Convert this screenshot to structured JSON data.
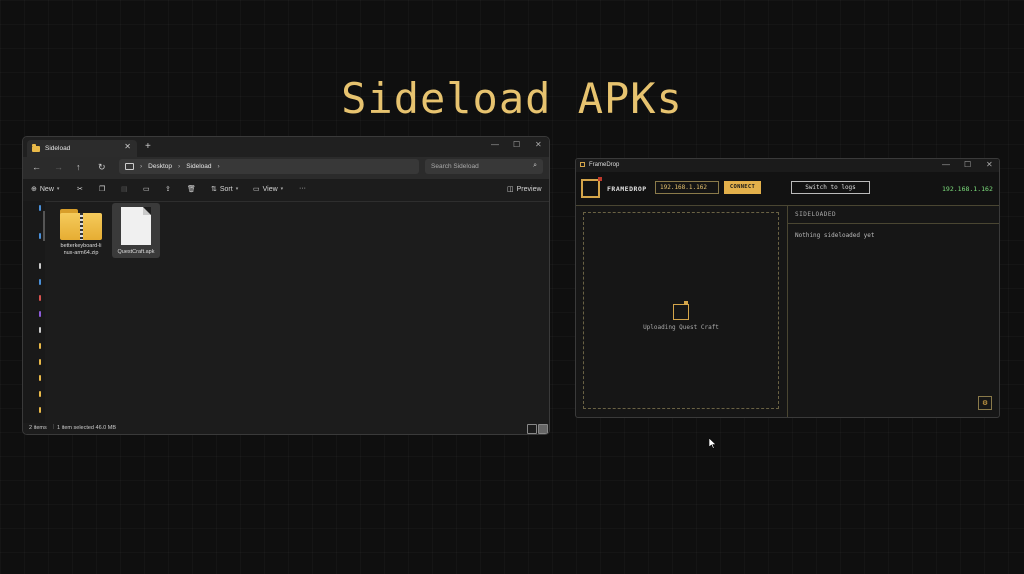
{
  "headline": "Sideload APKs",
  "explorer": {
    "tab_title": "Sideload",
    "breadcrumb": [
      "Desktop",
      "Sideload"
    ],
    "search_placeholder": "Search Sideload",
    "toolbar": {
      "new_label": "New",
      "sort_label": "Sort",
      "view_label": "View",
      "more_label": "···",
      "preview_label": "Preview"
    },
    "files": [
      {
        "name": "betterkeyboard-linux-arm64.zip",
        "line1": "betterkeyboard-li",
        "line2": "nux-arm64.zip",
        "type": "zip-folder"
      },
      {
        "name": "QuestCraft.apk",
        "type": "document",
        "selected": true
      }
    ],
    "status": {
      "items": "2 items",
      "selection": "1 item selected  46.0 MB"
    }
  },
  "framedrop": {
    "window_title": "FrameDrop",
    "brand": "FRAMEDROP",
    "ip_value": "192.168.1.162",
    "connect_label": "CONNECT",
    "switch_label": "Switch to logs",
    "connected_ip": "192.168.1.162",
    "upload_status": "Uploading Quest Craft",
    "sideloaded_heading": "SIDELOADED",
    "sideloaded_empty": "Nothing sideloaded yet"
  },
  "colors": {
    "accent": "#e3b04b",
    "headline": "#e7c36f",
    "connected": "#7ddf7d",
    "background": "#0f0f0f"
  }
}
